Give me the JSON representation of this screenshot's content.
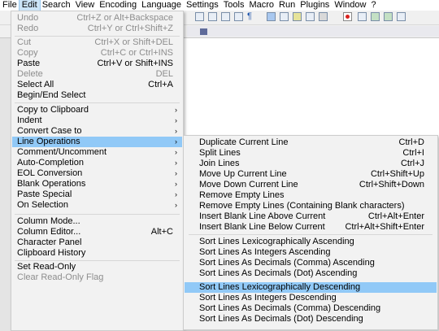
{
  "menubar": {
    "items": [
      "File",
      "Edit",
      "Search",
      "View",
      "Encoding",
      "Language",
      "Settings",
      "Tools",
      "Macro",
      "Run",
      "Plugins",
      "Window",
      "?"
    ]
  },
  "toolbar": {
    "icons": [
      "new-file-icon",
      "open-file-icon",
      "save-icon",
      "indent-guide-icon",
      "paragraph-icon",
      "wrap-icon",
      "function-list-icon",
      "doc-map-icon",
      "folder-workspace-icon",
      "monitor-icon",
      "record-macro-icon",
      "stop-record-icon",
      "play-macro-icon",
      "run-macro-multiple-icon",
      "save-macro-icon"
    ]
  },
  "edit_menu": {
    "items": [
      {
        "label": "Undo",
        "shortcut": "Ctrl+Z or Alt+Backspace",
        "disabled": true
      },
      {
        "label": "Redo",
        "shortcut": "Ctrl+Y or Ctrl+Shift+Z",
        "disabled": true
      },
      {
        "label": "Cut",
        "shortcut": "Ctrl+X or Shift+DEL",
        "disabled": true
      },
      {
        "label": "Copy",
        "shortcut": "Ctrl+C or Ctrl+INS",
        "disabled": true
      },
      {
        "label": "Paste",
        "shortcut": "Ctrl+V or Shift+INS",
        "disabled": false
      },
      {
        "label": "Delete",
        "shortcut": "DEL",
        "disabled": true
      },
      {
        "label": "Select All",
        "shortcut": "Ctrl+A",
        "disabled": false
      },
      {
        "label": "Begin/End Select",
        "shortcut": "",
        "disabled": false
      },
      {
        "label": "Copy to Clipboard",
        "shortcut": "",
        "submenu": true
      },
      {
        "label": "Indent",
        "shortcut": "",
        "submenu": true
      },
      {
        "label": "Convert Case to",
        "shortcut": "",
        "submenu": true
      },
      {
        "label": "Line Operations",
        "shortcut": "",
        "submenu": true,
        "highlighted": true
      },
      {
        "label": "Comment/Uncomment",
        "shortcut": "",
        "submenu": true
      },
      {
        "label": "Auto-Completion",
        "shortcut": "",
        "submenu": true
      },
      {
        "label": "EOL Conversion",
        "shortcut": "",
        "submenu": true
      },
      {
        "label": "Blank Operations",
        "shortcut": "",
        "submenu": true
      },
      {
        "label": "Paste Special",
        "shortcut": "",
        "submenu": true
      },
      {
        "label": "On Selection",
        "shortcut": "",
        "submenu": true
      },
      {
        "label": "Column Mode...",
        "shortcut": ""
      },
      {
        "label": "Column Editor...",
        "shortcut": "Alt+C"
      },
      {
        "label": "Character Panel",
        "shortcut": ""
      },
      {
        "label": "Clipboard History",
        "shortcut": ""
      },
      {
        "label": "Set Read-Only",
        "shortcut": ""
      },
      {
        "label": "Clear Read-Only Flag",
        "shortcut": "",
        "disabled": true
      }
    ]
  },
  "line_ops_menu": {
    "items": [
      {
        "label": "Duplicate Current Line",
        "shortcut": "Ctrl+D"
      },
      {
        "label": "Split Lines",
        "shortcut": "Ctrl+I"
      },
      {
        "label": "Join Lines",
        "shortcut": "Ctrl+J"
      },
      {
        "label": "Move Up Current Line",
        "shortcut": "Ctrl+Shift+Up"
      },
      {
        "label": "Move Down Current Line",
        "shortcut": "Ctrl+Shift+Down"
      },
      {
        "label": "Remove Empty Lines",
        "shortcut": ""
      },
      {
        "label": "Remove Empty Lines (Containing Blank characters)",
        "shortcut": ""
      },
      {
        "label": "Insert Blank Line Above Current",
        "shortcut": "Ctrl+Alt+Enter"
      },
      {
        "label": "Insert Blank Line Below Current",
        "shortcut": "Ctrl+Alt+Shift+Enter"
      },
      {
        "label": "Sort Lines Lexicographically Ascending",
        "shortcut": ""
      },
      {
        "label": "Sort Lines As Integers Ascending",
        "shortcut": ""
      },
      {
        "label": "Sort Lines As Decimals (Comma) Ascending",
        "shortcut": ""
      },
      {
        "label": "Sort Lines As Decimals (Dot) Ascending",
        "shortcut": ""
      },
      {
        "label": "Sort Lines Lexicographically Descending",
        "shortcut": "",
        "highlighted": true
      },
      {
        "label": "Sort Lines As Integers Descending",
        "shortcut": ""
      },
      {
        "label": "Sort Lines As Decimals (Comma) Descending",
        "shortcut": ""
      },
      {
        "label": "Sort Lines As Decimals (Dot) Descending",
        "shortcut": ""
      }
    ]
  },
  "arrow_glyph": "›"
}
